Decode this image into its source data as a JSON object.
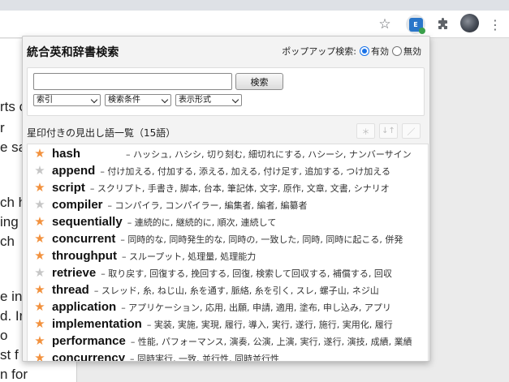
{
  "browser": {
    "star_icon": "star-outline-icon",
    "extension_icon": "eiji-extension-icon",
    "extension_logo_text": "E",
    "puzzle_icon": "puzzle-icon",
    "menu_icon": "more-vert-icon"
  },
  "page_text": [
    "rts c",
    "r",
    "e sa",
    "ch h",
    "ing",
    "ch",
    "e in",
    "d. Ir",
    "o",
    "st f",
    "n for"
  ],
  "popup": {
    "title": "統合英和辞書検索",
    "popup_search_label": "ポップアップ検索:",
    "radio_on_label": "有効",
    "radio_off_label": "無効",
    "search_input_value": "",
    "search_button": "検索",
    "select_index": "索引",
    "select_conditions": "検索条件",
    "select_format": "表示形式",
    "list_header": "星印付きの見出し語一覧（15語）",
    "header_buttons": [
      "＊",
      "↓↑",
      "／"
    ],
    "accent_color": "#f2913d",
    "entries": [
      {
        "starred": true,
        "word": "hash",
        "def": "– ハッシュ, ハシシ, 切り刻む, 細切れにする, ハシーシ, ナンバーサイン"
      },
      {
        "starred": false,
        "word": "append",
        "def": "– 付け加える, 付加する, 添える, 加える, 付け足す, 追加する, つけ加える"
      },
      {
        "starred": true,
        "word": "script",
        "def": "– スクリプト, 手書き, 脚本, 台本, 筆記体, 文字, 原作, 文章, 文書, シナリオ"
      },
      {
        "starred": false,
        "word": "compiler",
        "def": "– コンパイラ, コンパイラー, 編集者, 編者, 編纂者"
      },
      {
        "starred": true,
        "word": "sequentially",
        "def": "– 連続的に, 継続的に, 順次, 連続して"
      },
      {
        "starred": true,
        "word": "concurrent",
        "def": "– 同時的な, 同時発生的な, 同時の, 一致した, 同時, 同時に起こる, 併発"
      },
      {
        "starred": true,
        "word": "throughput",
        "def": "– スループット, 処理量, 処理能力"
      },
      {
        "starred": false,
        "word": "retrieve",
        "def": "– 取り戻す, 回復する, 挽回する, 回復, 検索して回収する, 補償する, 回収"
      },
      {
        "starred": true,
        "word": "thread",
        "def": "– スレッド, 糸, ねじ山, 糸を通す, 脈絡, 糸を引く, スレ, 螺子山, ネジ山"
      },
      {
        "starred": true,
        "word": "application",
        "def": "– アプリケーション, 応用, 出願, 申請, 適用, 塗布, 申し込み, アプリ"
      },
      {
        "starred": true,
        "word": "implementation",
        "def": "– 実装, 実施, 実現, 履行, 導入, 実行, 遂行, 施行, 実用化, 履行"
      },
      {
        "starred": true,
        "word": "performance",
        "def": "– 性能, パフォーマンス, 演奏, 公演, 上演, 実行, 遂行, 演技, 成績, 業績"
      },
      {
        "starred": true,
        "word": "concurrency",
        "def": "– 同時実行, 一致, 並行性, 同時並行性"
      }
    ]
  }
}
